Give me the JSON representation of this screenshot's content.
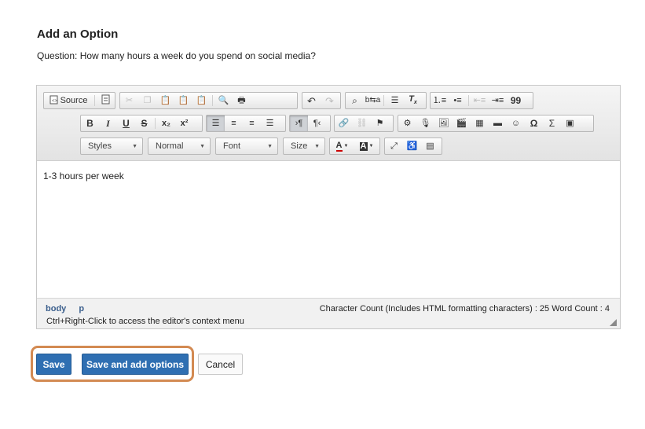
{
  "form": {
    "heading": "Add an Option",
    "question": "Question: How many hours a week do you spend on social media?"
  },
  "toolbar": {
    "source_label": "Source",
    "styles_label": "Styles",
    "format_label": "Normal",
    "font_label": "Font",
    "size_label": "Size",
    "bold": "B",
    "italic": "I",
    "underline": "U",
    "strike": "S",
    "subscript": "x₂",
    "superscript": "x²",
    "blockquote": "99",
    "omega": "Ω",
    "sigma": "Σ",
    "text_color": "A",
    "bg_color": "A"
  },
  "editor": {
    "content": "1-3 hours per week"
  },
  "statusbar": {
    "path_body": "body",
    "path_p": "p",
    "counts": "Character Count (Includes HTML formatting characters) : 25 Word Count : 4",
    "hint": "Ctrl+Right-Click to access the editor's context menu"
  },
  "actions": {
    "save": "Save",
    "save_add": "Save and add options",
    "cancel": "Cancel"
  },
  "colors": {
    "primary": "#2f6fb2",
    "highlight": "#d38a52"
  }
}
